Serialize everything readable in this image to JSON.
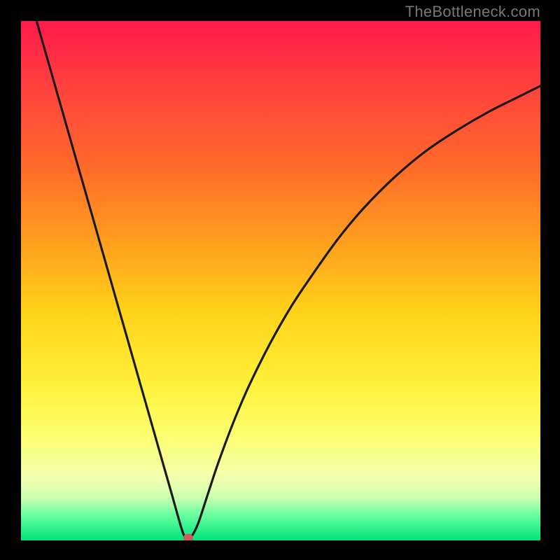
{
  "attribution": "TheBottleneck.com",
  "colors": {
    "page_bg": "#000000",
    "gradient_top": "#ff1a4b",
    "gradient_bottom": "#00e47a",
    "curve": "#1a1a1a",
    "marker": "#d15a5a"
  },
  "chart_data": {
    "type": "line",
    "title": "",
    "xlabel": "",
    "ylabel": "",
    "xlim": [
      0,
      100
    ],
    "ylim": [
      0,
      100
    ],
    "grid": false,
    "legend": false,
    "series": [
      {
        "name": "bottleneck-curve",
        "x": [
          3,
          5,
          7,
          9,
          11,
          13,
          15,
          17,
          19,
          21,
          23,
          25,
          27,
          29,
          31,
          31.8,
          32.6,
          34,
          36,
          38,
          41,
          44,
          48,
          52,
          56,
          61,
          66,
          72,
          78,
          84,
          90,
          96,
          100
        ],
        "values": [
          100,
          93,
          86,
          79,
          72,
          65,
          58,
          51,
          44,
          37,
          30,
          23,
          16,
          9,
          2,
          0.5,
          0.5,
          3,
          9,
          15,
          23,
          30,
          38,
          45,
          51,
          58,
          64,
          70,
          75,
          79,
          82.5,
          85.5,
          87.5
        ]
      }
    ],
    "annotations": [
      {
        "name": "minimum-marker",
        "shape": "ellipse",
        "x": 32.2,
        "y": 0,
        "color": "#d15a5a"
      }
    ]
  }
}
